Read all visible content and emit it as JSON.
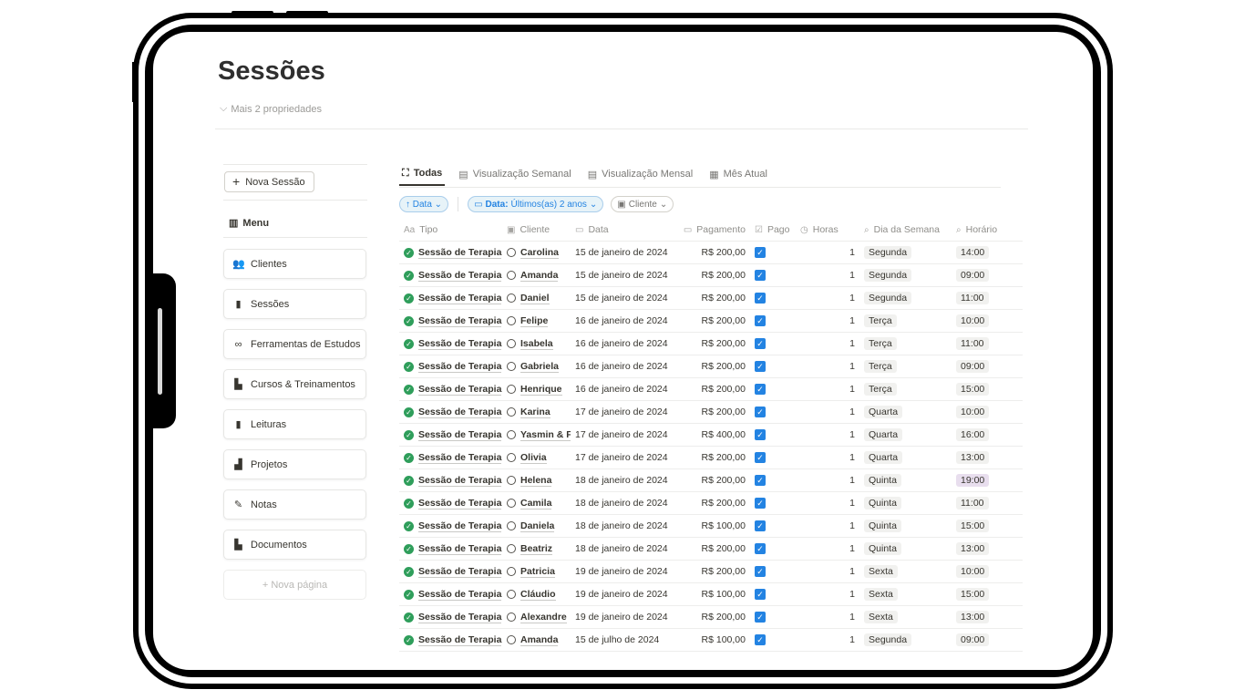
{
  "page": {
    "title": "Sessões",
    "more_properties": "Mais 2 propriedades"
  },
  "sidebar": {
    "new_session_label": "Nova Sessão",
    "menu_label": "Menu",
    "items": [
      {
        "label": "Clientes",
        "icon": "people-icon"
      },
      {
        "label": "Sessões",
        "icon": "clipboard-icon"
      },
      {
        "label": "Ferramentas de Estudos",
        "icon": "link-icon"
      },
      {
        "label": "Cursos & Treinamentos",
        "icon": "books-icon"
      },
      {
        "label": "Leituras",
        "icon": "book-icon"
      },
      {
        "label": "Projetos",
        "icon": "chart-icon"
      },
      {
        "label": "Notas",
        "icon": "edit-icon"
      },
      {
        "label": "Documentos",
        "icon": "document-icon"
      }
    ],
    "new_page_label": "+ Nova página"
  },
  "tabs": [
    {
      "label": "Todas",
      "icon": "expand-icon",
      "active": true
    },
    {
      "label": "Visualização Semanal",
      "icon": "calendar-icon",
      "active": false
    },
    {
      "label": "Visualização Mensal",
      "icon": "calendar-icon",
      "active": false
    },
    {
      "label": "Mês Atual",
      "icon": "calendar-clock-icon",
      "active": false
    }
  ],
  "filters": {
    "sort_label": "↑ Data ⌄",
    "date_filter_prefix": "Data:",
    "date_filter_value": "Últimos(as) 2 anos",
    "client_filter": "Cliente"
  },
  "table": {
    "columns": {
      "tipo": "Tipo",
      "tipo_icon": "Aa",
      "cliente": "Cliente",
      "data": "Data",
      "pagamento": "Pagamento",
      "pago": "Pago",
      "horas": "Horas",
      "dia": "Dia da Semana",
      "horario": "Horário"
    },
    "rows": [
      {
        "tipo": "Sessão de Terapia",
        "cliente": "Carolina",
        "data": "15 de janeiro de 2024",
        "pagamento": "R$ 200,00",
        "pago": true,
        "horas": "1",
        "dia": "Segunda",
        "horario": "14:00"
      },
      {
        "tipo": "Sessão de Terapia",
        "cliente": "Amanda",
        "data": "15 de janeiro de 2024",
        "pagamento": "R$ 200,00",
        "pago": true,
        "horas": "1",
        "dia": "Segunda",
        "horario": "09:00"
      },
      {
        "tipo": "Sessão de Terapia",
        "cliente": "Daniel",
        "data": "15 de janeiro de 2024",
        "pagamento": "R$ 200,00",
        "pago": true,
        "horas": "1",
        "dia": "Segunda",
        "horario": "11:00"
      },
      {
        "tipo": "Sessão de Terapia",
        "cliente": "Felipe",
        "data": "16 de janeiro de 2024",
        "pagamento": "R$ 200,00",
        "pago": true,
        "horas": "1",
        "dia": "Terça",
        "horario": "10:00"
      },
      {
        "tipo": "Sessão de Terapia",
        "cliente": "Isabela",
        "data": "16 de janeiro de 2024",
        "pagamento": "R$ 200,00",
        "pago": true,
        "horas": "1",
        "dia": "Terça",
        "horario": "11:00"
      },
      {
        "tipo": "Sessão de Terapia",
        "cliente": "Gabriela",
        "data": "16 de janeiro de 2024",
        "pagamento": "R$ 200,00",
        "pago": true,
        "horas": "1",
        "dia": "Terça",
        "horario": "09:00"
      },
      {
        "tipo": "Sessão de Terapia",
        "cliente": "Henrique",
        "data": "16 de janeiro de 2024",
        "pagamento": "R$ 200,00",
        "pago": true,
        "horas": "1",
        "dia": "Terça",
        "horario": "15:00"
      },
      {
        "tipo": "Sessão de Terapia",
        "cliente": "Karina",
        "data": "17 de janeiro de 2024",
        "pagamento": "R$ 200,00",
        "pago": true,
        "horas": "1",
        "dia": "Quarta",
        "horario": "10:00"
      },
      {
        "tipo": "Sessão de Terapia",
        "cliente": "Yasmin & F",
        "data": "17 de janeiro de 2024",
        "pagamento": "R$ 400,00",
        "pago": true,
        "horas": "1",
        "dia": "Quarta",
        "horario": "16:00"
      },
      {
        "tipo": "Sessão de Terapia",
        "cliente": "Olivia",
        "data": "17 de janeiro de 2024",
        "pagamento": "R$ 200,00",
        "pago": true,
        "horas": "1",
        "dia": "Quarta",
        "horario": "13:00"
      },
      {
        "tipo": "Sessão de Terapia",
        "cliente": "Helena",
        "data": "18 de janeiro de 2024",
        "pagamento": "R$ 200,00",
        "pago": true,
        "horas": "1",
        "dia": "Quinta",
        "horario": "19:00",
        "horario_color": "#e8deee"
      },
      {
        "tipo": "Sessão de Terapia",
        "cliente": "Camila",
        "data": "18 de janeiro de 2024",
        "pagamento": "R$ 200,00",
        "pago": true,
        "horas": "1",
        "dia": "Quinta",
        "horario": "11:00"
      },
      {
        "tipo": "Sessão de Terapia",
        "cliente": "Daniela",
        "data": "18 de janeiro de 2024",
        "pagamento": "R$ 100,00",
        "pago": true,
        "horas": "1",
        "dia": "Quinta",
        "horario": "15:00"
      },
      {
        "tipo": "Sessão de Terapia",
        "cliente": "Beatriz",
        "data": "18 de janeiro de 2024",
        "pagamento": "R$ 200,00",
        "pago": true,
        "horas": "1",
        "dia": "Quinta",
        "horario": "13:00"
      },
      {
        "tipo": "Sessão de Terapia",
        "cliente": "Patricia",
        "data": "19 de janeiro de 2024",
        "pagamento": "R$ 200,00",
        "pago": true,
        "horas": "1",
        "dia": "Sexta",
        "horario": "10:00"
      },
      {
        "tipo": "Sessão de Terapia",
        "cliente": "Cláudio",
        "data": "19 de janeiro de 2024",
        "pagamento": "R$ 100,00",
        "pago": true,
        "horas": "1",
        "dia": "Sexta",
        "horario": "15:00"
      },
      {
        "tipo": "Sessão de Terapia",
        "cliente": "Alexandre",
        "data": "19 de janeiro de 2024",
        "pagamento": "R$ 200,00",
        "pago": true,
        "horas": "1",
        "dia": "Sexta",
        "horario": "13:00"
      },
      {
        "tipo": "Sessão de Terapia",
        "cliente": "Amanda",
        "data": "15 de julho de 2024",
        "pagamento": "R$ 100,00",
        "pago": true,
        "horas": "1",
        "dia": "Segunda",
        "horario": "09:00"
      }
    ]
  },
  "colors": {
    "accent": "#2383e2",
    "done_green": "#2f9e5b",
    "frame": "#000000"
  }
}
